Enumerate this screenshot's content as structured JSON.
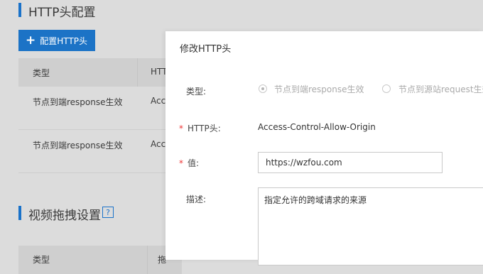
{
  "background": {
    "section1": {
      "title": "HTTP头配置"
    },
    "config_button": {
      "label": "配置HTTP头",
      "icon": "plus-icon"
    },
    "table1": {
      "headers": [
        "类型",
        "HTTP"
      ],
      "rows": [
        [
          "节点到端response生效",
          "Acc"
        ],
        [
          "节点到端response生效",
          "Acc"
        ]
      ]
    },
    "section2": {
      "title": "视频拖拽设置",
      "help": "?"
    },
    "table2": {
      "headers": [
        "类型",
        "拖"
      ]
    }
  },
  "modal": {
    "title": "修改HTTP头",
    "type_field": {
      "label": "类型:",
      "options": [
        {
          "label": "节点到端response生效",
          "checked": true
        },
        {
          "label": "节点到源站request生效",
          "checked": false
        }
      ]
    },
    "header_field": {
      "label": "HTTP头:",
      "required": "*",
      "value": "Access-Control-Allow-Origin"
    },
    "value_field": {
      "label": "值:",
      "required": "*",
      "value": "https://wzfou.com"
    },
    "desc_field": {
      "label": "描述:",
      "value": "指定允许的跨域请求的来源"
    }
  },
  "colors": {
    "accent": "#1c73c6",
    "required": "#ee3333"
  }
}
